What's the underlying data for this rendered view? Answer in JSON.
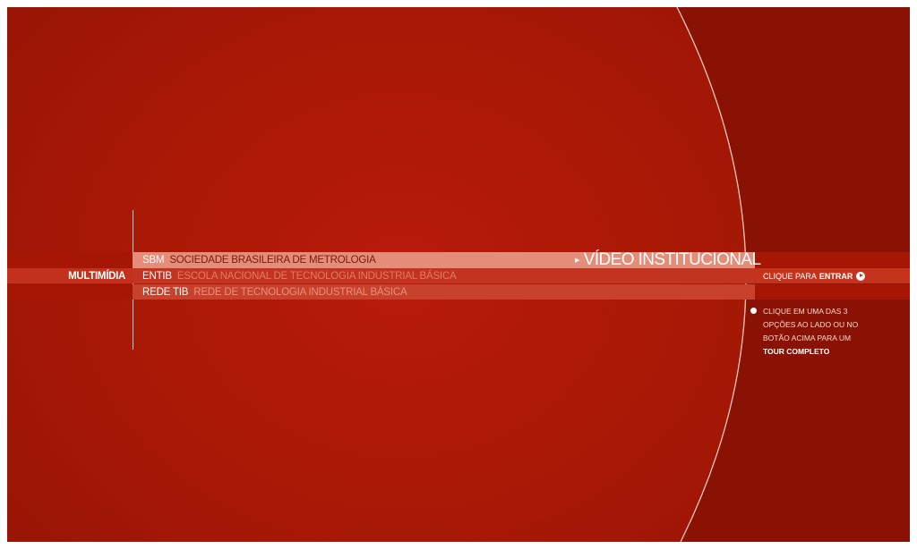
{
  "colors": {
    "background": "#a81806",
    "right_panel": "#8a1204",
    "sbm_row": "#e48d79",
    "entib_row": "#c23320",
    "rede_row": "#c8412c",
    "arc_line": "#f4c7b8",
    "text_white": "#ffffff"
  },
  "menu": {
    "label": "MULTIMÍDIA",
    "items": [
      {
        "abbr": "SBM",
        "description": "SOCIEDADE BRASILEIRA DE METROLOGIA"
      },
      {
        "abbr": "ENTIB",
        "description": "ESCOLA NACIONAL DE TECNOLOGIA INDUSTRIAL BÁSICA"
      },
      {
        "abbr": "REDE TIB",
        "description": "REDE DE TECNOLOGIA INDUSTRIAL BÁSICA"
      }
    ]
  },
  "video": {
    "label": "VÍDEO INSTITUCIONAL",
    "icon": "play-triangle-icon"
  },
  "enter": {
    "prefix": "CLIQUE PARA",
    "action": "ENTRAR",
    "icon": "play-circle-icon"
  },
  "tip": {
    "lines": [
      "CLIQUE EM UMA DAS 3",
      "OPÇÕES AO LADO OU NO",
      "BOTÃO ACIMA PARA UM"
    ],
    "emphasis": "TOUR COMPLETO"
  }
}
